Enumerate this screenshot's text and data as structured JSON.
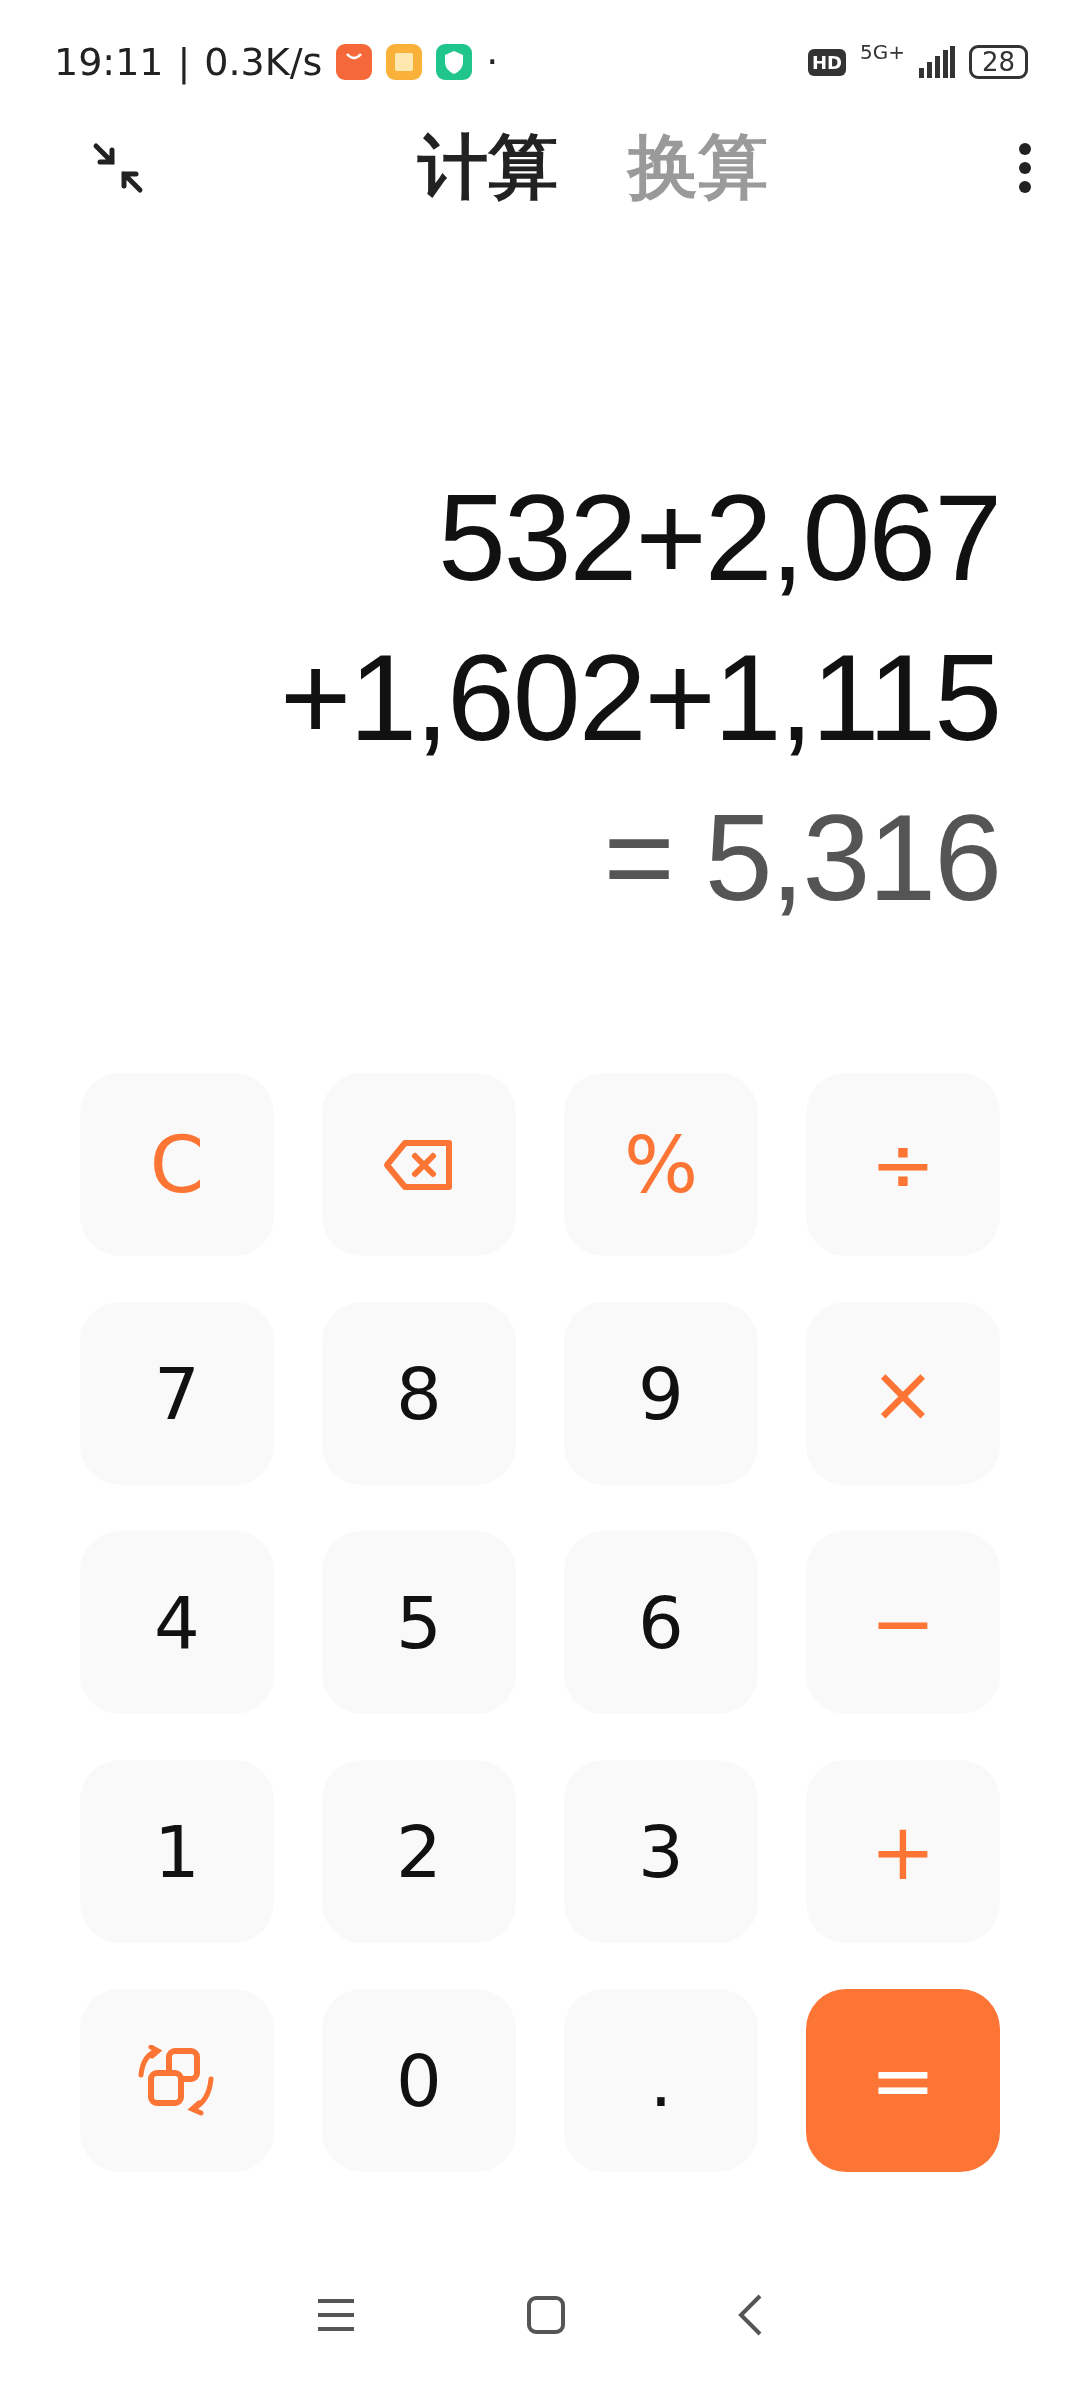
{
  "status_bar": {
    "time": "19:11",
    "divider": "|",
    "speed": "0.3K/s",
    "dot": "·",
    "hd": "HD",
    "network": "5G+",
    "battery": "28"
  },
  "tabs": [
    {
      "label": "计算",
      "selected": true
    },
    {
      "label": "换算",
      "selected": false
    }
  ],
  "display": {
    "expression_lines": [
      "532+2,067",
      "+1,602+1,115"
    ],
    "result": "= 5,316"
  },
  "keys": [
    {
      "kind": "operator",
      "label": "C"
    },
    {
      "kind": "backspace"
    },
    {
      "kind": "operator",
      "label": "%"
    },
    {
      "kind": "operator",
      "label": "÷"
    },
    {
      "kind": "digit",
      "label": "7"
    },
    {
      "kind": "digit",
      "label": "8"
    },
    {
      "kind": "digit",
      "label": "9"
    },
    {
      "kind": "operator",
      "label": "×"
    },
    {
      "kind": "digit",
      "label": "4"
    },
    {
      "kind": "digit",
      "label": "5"
    },
    {
      "kind": "digit",
      "label": "6"
    },
    {
      "kind": "operator",
      "label": "−"
    },
    {
      "kind": "digit",
      "label": "1"
    },
    {
      "kind": "digit",
      "label": "2"
    },
    {
      "kind": "digit",
      "label": "3"
    },
    {
      "kind": "operator",
      "label": "+"
    },
    {
      "kind": "convert"
    },
    {
      "kind": "digit",
      "label": "0"
    },
    {
      "kind": "digit",
      "label": "."
    },
    {
      "kind": "equals",
      "label": "="
    }
  ]
}
